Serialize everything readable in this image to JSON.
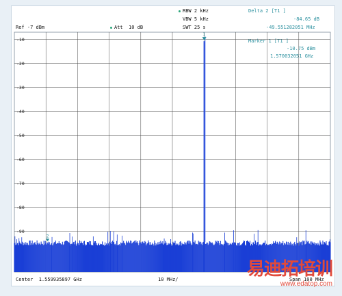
{
  "header": {
    "rbw": "RBW 2 kHz",
    "vbw": "VBW 5 kHz",
    "swt": "SWT 25 s",
    "ref": "Ref -7 dBm",
    "att": "Att  10 dB",
    "delta_title": "Delta 2 [T1 ]",
    "delta_level": "-84.65 dB",
    "delta_freq": "-49.551282051 MHz",
    "marker_title": "Marker 1 [T1 ]",
    "marker_level": "-10.75 dBm",
    "marker_freq": "1.570032051 GHz"
  },
  "footer": {
    "center": "Center  1.559935897 GHz",
    "span_div": "10 MHz/",
    "span": "Span 100 MHz"
  },
  "watermark": {
    "cn": "易迪拓培训",
    "url": "www.edatop.com"
  },
  "marker_labels": {
    "m1": "1",
    "m2": "2"
  },
  "colors": {
    "trace": "#1a3fd6",
    "grid": "#4a4a4a",
    "teal": "#2a8f9e",
    "watermark": "#e24a3a"
  },
  "chart_data": {
    "type": "line",
    "title": "",
    "xlabel": "Center 1.559935897 GHz  10 MHz/  Span 100 MHz",
    "ylabel": "",
    "x_unit": "GHz",
    "y_unit": "dBm",
    "xlim": [
      1.509935897,
      1.609935897
    ],
    "ylim": [
      -107,
      -7
    ],
    "y_ticks": [
      -10,
      -20,
      -30,
      -40,
      -50,
      -60,
      -70,
      -80,
      -90
    ],
    "y_tick_labels": [
      "-10",
      "-20",
      "-30",
      "-40",
      "-50",
      "-60",
      "-70",
      "-80",
      "-90"
    ],
    "grid": true,
    "noise_floor_dbm": -95.4,
    "series": [
      {
        "name": "",
        "peaks": [
          {
            "x": 1.570032051,
            "y": -10.75,
            "label": "1"
          },
          {
            "x": 1.520480769,
            "y": -95.4,
            "label": "2"
          }
        ]
      }
    ]
  }
}
